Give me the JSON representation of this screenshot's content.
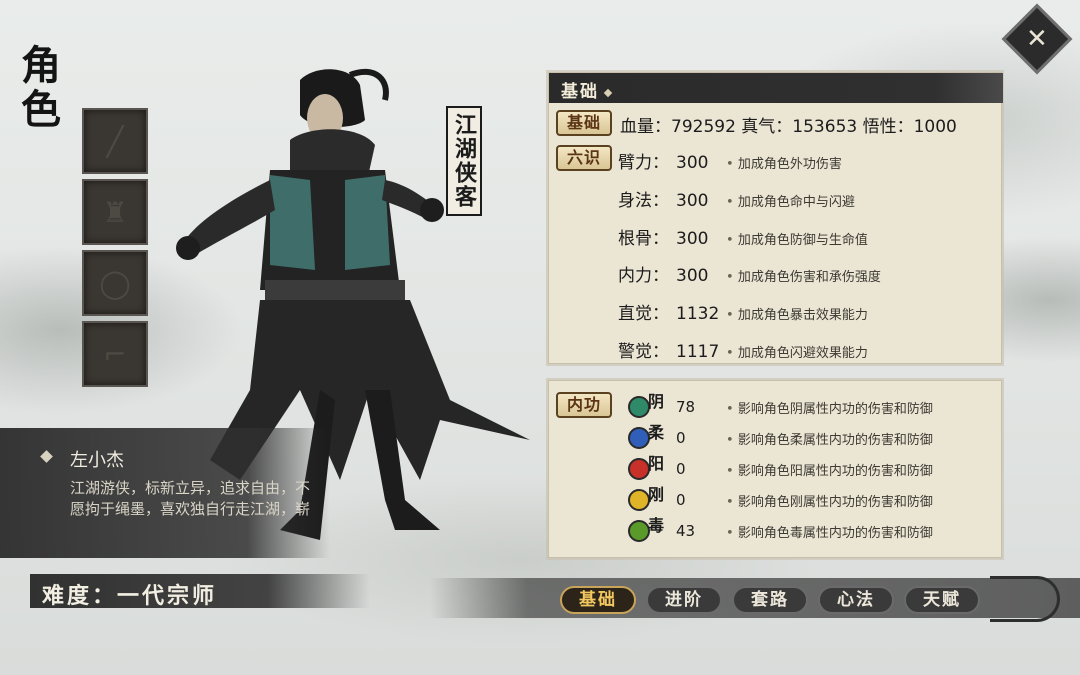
{
  "close": {
    "label": "✕"
  },
  "sidebar": {
    "title": "角色",
    "slots": [
      "slot-weapon",
      "slot-armor",
      "slot-accessory",
      "slot-boots"
    ]
  },
  "character": {
    "title": "江湖侠客",
    "name": "左小杰",
    "description": "江湖游侠，标新立异，追求自由，不愿拘于绳墨，喜欢独自行走江湖，崭",
    "difficulty": "难度：一代宗师"
  },
  "base_panel": {
    "header": "基础",
    "base_tag": "基础",
    "stats_line": "血量：792592 真气：153653 悟性：1000",
    "liushi_tag": "六识",
    "attributes": [
      {
        "label": "臂力：",
        "value": "300",
        "desc": "加成角色外功伤害"
      },
      {
        "label": "身法：",
        "value": "300",
        "desc": "加成角色命中与闪避"
      },
      {
        "label": "根骨：",
        "value": "300",
        "desc": "加成角色防御与生命值"
      },
      {
        "label": "内力：",
        "value": "300",
        "desc": "加成角色伤害和承伤强度"
      },
      {
        "label": "直觉：",
        "value": "1132",
        "desc": "加成角色暴击效果能力"
      },
      {
        "label": "警觉：",
        "value": "1117",
        "desc": "加成角色闪避效果能力"
      }
    ]
  },
  "neigong_panel": {
    "tag": "内功",
    "elements": [
      {
        "name": "阴",
        "value": "78",
        "desc": "影响角色阴属性内功的伤害和防御",
        "color": "#2f8a6a"
      },
      {
        "name": "柔",
        "value": "0",
        "desc": "影响角色柔属性内功的伤害和防御",
        "color": "#2f5fb8"
      },
      {
        "name": "阳",
        "value": "0",
        "desc": "影响角色阳属性内功的伤害和防御",
        "color": "#c8302a"
      },
      {
        "name": "刚",
        "value": "0",
        "desc": "影响角色刚属性内功的伤害和防御",
        "color": "#e0b428"
      },
      {
        "name": "毒",
        "value": "43",
        "desc": "影响角色毒属性内功的伤害和防御",
        "color": "#5a9a2a"
      }
    ]
  },
  "tabs": [
    {
      "label": "基础",
      "active": true
    },
    {
      "label": "进阶",
      "active": false
    },
    {
      "label": "套路",
      "active": false
    },
    {
      "label": "心法",
      "active": false
    },
    {
      "label": "天赋",
      "active": false
    }
  ]
}
